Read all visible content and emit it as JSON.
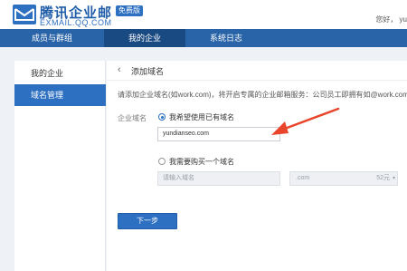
{
  "header": {
    "brand_title": "腾讯企业邮",
    "brand_badge": "免费版",
    "brand_sub": "EXMAIL.QQ.COM",
    "greeting": "您好， yu",
    "logo_icon": "mail-logo-icon"
  },
  "nav": {
    "tabs": [
      {
        "label": "成员与群组",
        "active": false
      },
      {
        "label": "我的企业",
        "active": true
      },
      {
        "label": "系统日志",
        "active": false
      }
    ]
  },
  "sidebar": {
    "items": [
      {
        "label": "我的企业",
        "active": false
      },
      {
        "label": "域名管理",
        "active": true
      }
    ]
  },
  "main": {
    "back_icon": "chevron-left-icon",
    "title": "添加域名",
    "intro": "请添加企业域名(如work.com)，将开启专属的企业邮箱服务：公司员工即拥有如@work.com为后缀的邮箱",
    "form_label": "企业域名",
    "option_existing": {
      "label": "我希望使用已有域名",
      "checked": true,
      "input_value": "yundianseo.com"
    },
    "option_buy": {
      "label": "我需要购买一个域名",
      "checked": false,
      "input_placeholder": "请输入域名",
      "suffix": ".com",
      "price": "52元",
      "caret": "▾"
    },
    "next_button": "下一步"
  },
  "colors": {
    "brand_blue": "#2d6fc0",
    "nav_blue": "#2a64a8",
    "annotation_arrow": "#e8452c"
  }
}
